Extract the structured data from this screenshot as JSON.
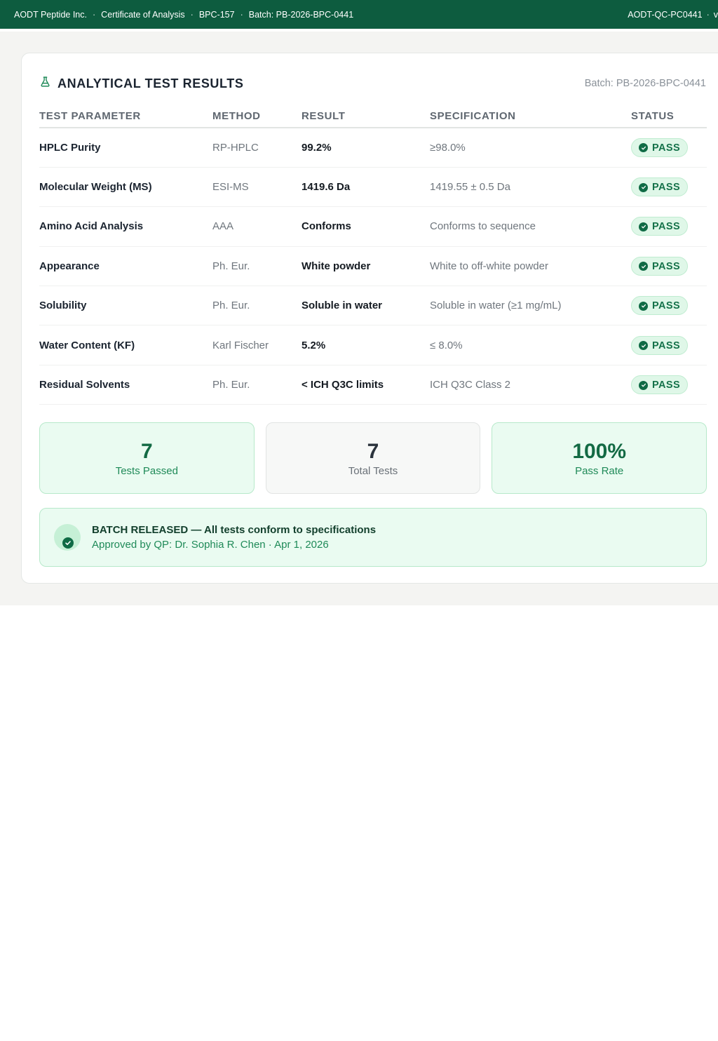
{
  "topbar": {
    "company": "AODT Peptide Inc.",
    "doc_type": "Certificate of Analysis",
    "product": "BPC-157",
    "batch": "Batch: PB-2026-BPC-0441",
    "doc_id": "AODT-QC-PC0441",
    "separator": "·",
    "trailing": "v"
  },
  "card": {
    "title": "ANALYTICAL TEST RESULTS",
    "title_icon": "flask-icon",
    "batch_ref": "Batch: PB-2026-BPC-0441"
  },
  "table": {
    "headers": [
      "TEST PARAMETER",
      "METHOD",
      "RESULT",
      "SPECIFICATION",
      "STATUS"
    ],
    "rows": [
      {
        "parameter": "HPLC Purity",
        "method": "RP-HPLC",
        "result": "99.2%",
        "spec": "≥98.0%",
        "status": "PASS"
      },
      {
        "parameter": "Molecular Weight (MS)",
        "method": "ESI-MS",
        "result": "1419.6 Da",
        "spec": "1419.55 ± 0.5 Da",
        "status": "PASS"
      },
      {
        "parameter": "Amino Acid Analysis",
        "method": "AAA",
        "result": "Conforms",
        "spec": "Conforms to sequence",
        "status": "PASS"
      },
      {
        "parameter": "Appearance",
        "method": "Ph. Eur.",
        "result": "White powder",
        "spec": "White to off-white powder",
        "status": "PASS"
      },
      {
        "parameter": "Solubility",
        "method": "Ph. Eur.",
        "result": "Soluble in water",
        "spec": "Soluble in water (≥1 mg/mL)",
        "status": "PASS"
      },
      {
        "parameter": "Water Content (KF)",
        "method": "Karl Fischer",
        "result": "5.2%",
        "spec": "≤ 8.0%",
        "status": "PASS"
      },
      {
        "parameter": "Residual Solvents",
        "method": "Ph. Eur.",
        "result": "< ICH Q3C limits",
        "spec": "ICH Q3C Class 2",
        "status": "PASS"
      }
    ]
  },
  "stats": {
    "passed": {
      "value": "7",
      "label": "Tests Passed"
    },
    "total": {
      "value": "7",
      "label": "Total Tests"
    },
    "rate": {
      "value": "100%",
      "label": "Pass Rate"
    }
  },
  "release": {
    "title": "BATCH RELEASED — All tests conform to specifications",
    "subtitle": "Approved by QP: Dr. Sophia R. Chen · Apr 1, 2026"
  },
  "colors": {
    "brand_green": "#0d5c3f",
    "pass_text": "#15724a",
    "pass_bg": "#dff7e8"
  }
}
